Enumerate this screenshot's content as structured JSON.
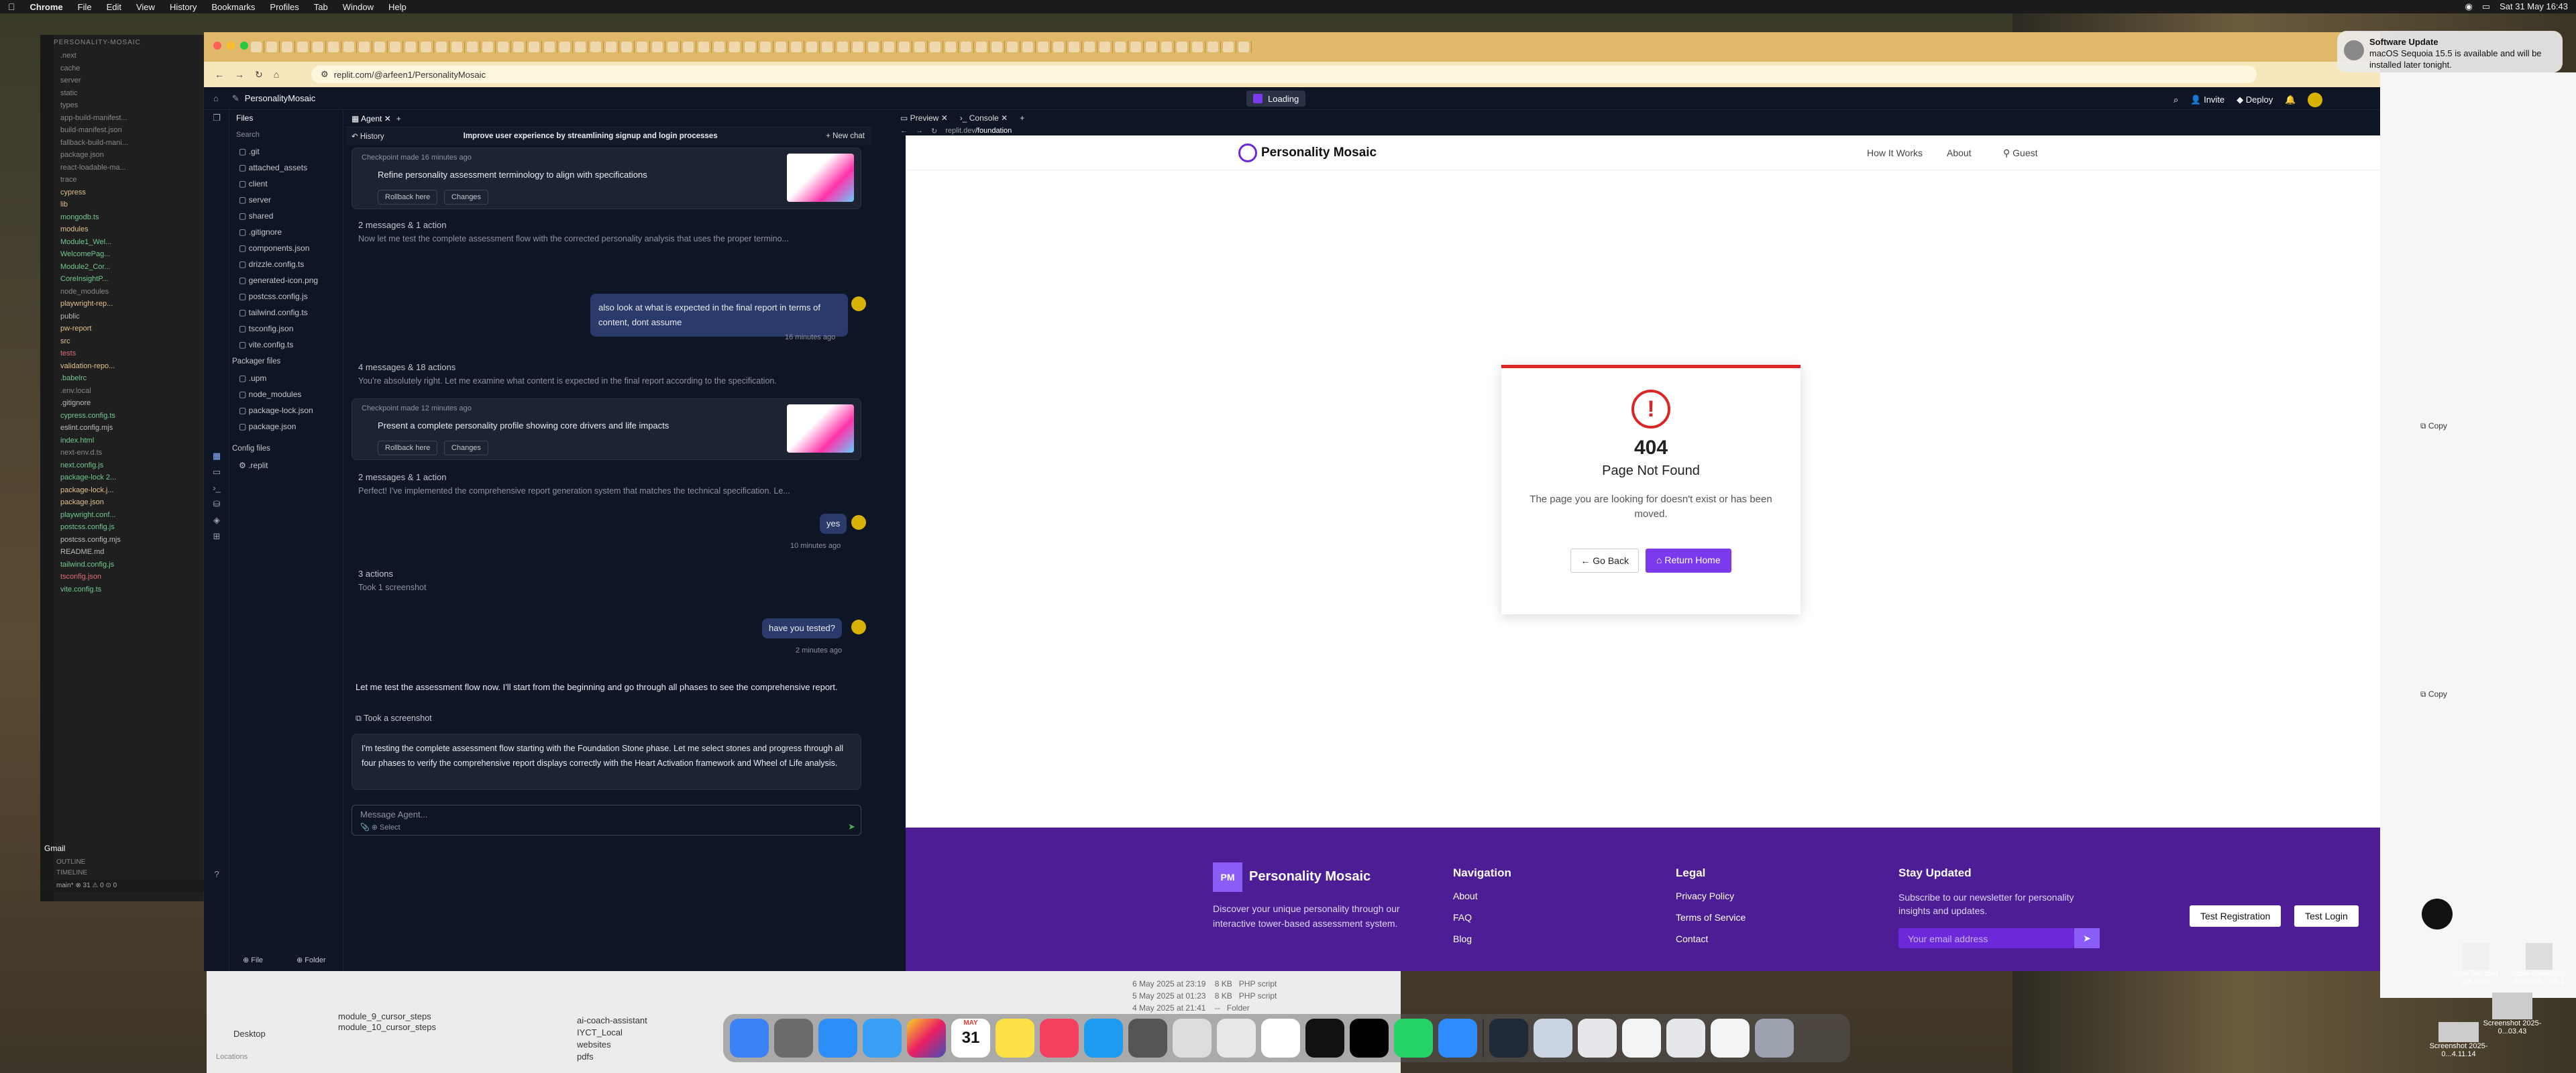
{
  "menubar": {
    "app": "Chrome",
    "items": [
      "File",
      "Edit",
      "View",
      "History",
      "Bookmarks",
      "Profiles",
      "Tab",
      "Window",
      "Help"
    ],
    "clock": "Sat 31 May 16:43"
  },
  "notification": {
    "title": "Software Update",
    "body": "macOS Sequoia 15.5 is available and will be installed later tonight."
  },
  "editor": {
    "title": "PERSONALITY-MOSAIC",
    "tree": [
      {
        "t": ".next",
        "c": "d"
      },
      {
        "t": "cache",
        "c": "d"
      },
      {
        "t": "server",
        "c": "d"
      },
      {
        "t": "static",
        "c": "d"
      },
      {
        "t": "types",
        "c": "d"
      },
      {
        "t": "app-build-manifest...",
        "c": "d"
      },
      {
        "t": "build-manifest.json",
        "c": "d"
      },
      {
        "t": "fallback-build-mani...",
        "c": "d"
      },
      {
        "t": "package.json",
        "c": "d"
      },
      {
        "t": "react-loadable-ma...",
        "c": "d"
      },
      {
        "t": "trace",
        "c": "d"
      },
      {
        "t": "cypress",
        "c": "m"
      },
      {
        "t": "lib",
        "c": "m"
      },
      {
        "t": "mongodb.ts",
        "c": "u"
      },
      {
        "t": "modules",
        "c": "m"
      },
      {
        "t": "Module1_Wel...",
        "c": "u"
      },
      {
        "t": "WelcomePag...",
        "c": "u"
      },
      {
        "t": "Module2_Cor...",
        "c": "u"
      },
      {
        "t": "CoreInsightP...",
        "c": "u"
      },
      {
        "t": "node_modules",
        "c": "d"
      },
      {
        "t": "playwright-rep...",
        "c": "m"
      },
      {
        "t": "public",
        "c": ""
      },
      {
        "t": "pw-report",
        "c": "m"
      },
      {
        "t": "src",
        "c": "m"
      },
      {
        "t": "tests",
        "c": "r"
      },
      {
        "t": "validation-repo...",
        "c": "m"
      },
      {
        "t": ".babelrc",
        "c": "u"
      },
      {
        "t": ".env.local",
        "c": "d"
      },
      {
        "t": ".gitignore",
        "c": ""
      },
      {
        "t": "cypress.config.ts",
        "c": "u"
      },
      {
        "t": "eslint.config.mjs",
        "c": ""
      },
      {
        "t": "index.html",
        "c": "u"
      },
      {
        "t": "next-env.d.ts",
        "c": "d"
      },
      {
        "t": "next.config.js",
        "c": "u"
      },
      {
        "t": "package-lock 2...",
        "c": "u"
      },
      {
        "t": "package-lock.j...",
        "c": "m"
      },
      {
        "t": "package.json",
        "c": "m"
      },
      {
        "t": "playwright.conf...",
        "c": "u"
      },
      {
        "t": "postcss.config.js",
        "c": "u"
      },
      {
        "t": "postcss.config.mjs",
        "c": ""
      },
      {
        "t": "README.md",
        "c": ""
      },
      {
        "t": "tailwind.config.js",
        "c": "u"
      },
      {
        "t": "tsconfig.json",
        "c": "r"
      },
      {
        "t": "vite.config.ts",
        "c": "u"
      }
    ],
    "outline": "OUTLINE",
    "timeline": "TIMELINE",
    "gmail": "Gmail",
    "status": "main* ⊗ 31 ⚠ 0 ⊙ 0"
  },
  "browser": {
    "url": "replit.com/@arfeen1/PersonalityMosaic"
  },
  "replit": {
    "project": "PersonalityMosaic",
    "status": "Loading",
    "invite": "Invite",
    "deploy": "Deploy",
    "files_title": "Files",
    "search": "Search",
    "files": [
      ".git",
      "attached_assets",
      "client",
      "server",
      "shared",
      ".gitignore",
      "components.json",
      "drizzle.config.ts",
      "generated-icon.png",
      "postcss.config.js",
      "tailwind.config.ts",
      "tsconfig.json",
      "vite.config.ts"
    ],
    "packager_title": "Packager files",
    "packager": [
      ".upm",
      "node_modules",
      "package-lock.json",
      "package.json"
    ],
    "config_title": "Config files",
    "config": [
      ".replit"
    ],
    "file_btn": "File",
    "folder_btn": "Folder"
  },
  "agent": {
    "tab": "Agent",
    "history": "History",
    "thread_title": "Improve user experience by streamlining signup and login processes",
    "new_chat": "New chat",
    "checkpoint1": {
      "meta": "Checkpoint made 16 minutes ago",
      "text": "Refine personality assessment terminology to align with specifications",
      "rollback": "Rollback here",
      "changes": "Changes"
    },
    "group1": {
      "title": "2 messages & 1 action",
      "text": "Now let me test the complete assessment flow with the corrected personality analysis that uses the proper termino..."
    },
    "user1": {
      "text": "also look at what is expected in the final report in terms of content, dont assume",
      "time": "16 minutes ago"
    },
    "group2": {
      "title": "4 messages & 18 actions",
      "text": "You're absolutely right. Let me examine what content is expected in the final report according to the specification."
    },
    "checkpoint2": {
      "meta": "Checkpoint made 12 minutes ago",
      "text": "Present a complete personality profile showing core drivers and life impacts",
      "rollback": "Rollback here",
      "changes": "Changes"
    },
    "group3": {
      "title": "2 messages & 1 action",
      "text": "Perfect! I've implemented the comprehensive report generation system that matches the technical specification. Le..."
    },
    "user2": {
      "text": "yes",
      "time": "10 minutes ago"
    },
    "group4": {
      "title": "3 actions",
      "text": "Took 1 screenshot"
    },
    "user3": {
      "text": "have you tested?",
      "time": "2 minutes ago"
    },
    "reply": "Let me test the assessment flow now. I'll start from the beginning and go through all phases to see the comprehensive report.",
    "screenshot_label": "Took a screenshot",
    "testing": "I'm testing the complete assessment flow starting with the Foundation Stone phase. Let me select stones and progress through all four phases to verify the comprehensive report displays correctly with the Heart Activation framework and Wheel of Life analysis.",
    "input_placeholder": "Message Agent...",
    "select": "Select"
  },
  "preview": {
    "tab_preview": "Preview",
    "tab_console": "Console",
    "url_host": "replit.dev",
    "url_path": "/foundation",
    "site_name": "Personality Mosaic",
    "nav": [
      "How It Works",
      "About",
      "Guest"
    ],
    "code": "404",
    "heading": "Page Not Found",
    "message": "The page you are looking for doesn't exist or has been moved.",
    "go_back": "Go Back",
    "return_home": "Return Home",
    "footer": {
      "logo": "PM",
      "brand": "Personality Mosaic",
      "tagline": "Discover your unique personality through our interactive tower-based assessment system.",
      "nav_title": "Navigation",
      "nav_links": [
        "About",
        "FAQ",
        "Blog"
      ],
      "legal_title": "Legal",
      "legal_links": [
        "Privacy Policy",
        "Terms of Service",
        "Contact"
      ],
      "stay_title": "Stay Updated",
      "stay_text": "Subscribe to our newsletter for personality insights and updates.",
      "email_placeholder": "Your email address",
      "test_reg": "Test Registration",
      "test_login": "Test Login"
    }
  },
  "finder": {
    "items": [
      "module_9_cursor_steps",
      "module_10_cursor_steps"
    ],
    "folders": [
      "ai-coach-assistant",
      "IYCT_Local",
      "websites",
      "pdfs"
    ],
    "rows": [
      {
        "d": "6 May 2025 at 23:19",
        "s": "8 KB",
        "k": "PHP script"
      },
      {
        "d": "5 May 2025 at 01:23",
        "s": "8 KB",
        "k": "PHP script"
      },
      {
        "d": "4 May 2025 at 21:41",
        "s": "--",
        "k": "Folder"
      }
    ],
    "desktop": "Desktop",
    "locations": "Locations"
  },
  "rightpanel": {
    "copy1": "Copy",
    "copy2": "Copy"
  },
  "desktop_files": [
    {
      "name": "base line chat gpt.docx"
    },
    {
      "name": "apple-developer-merchan...ion-2"
    },
    {
      "name": "Screenshot 2025-0...03.43"
    },
    {
      "name": "Screenshot 2025-0...4.11.14"
    }
  ],
  "dock_date": {
    "month": "MAY",
    "day": "31"
  },
  "colors": {
    "accent": "#7c3aed",
    "error": "#dc2626",
    "footer": "#4c1d95",
    "chrome_tab": "#dfb86a"
  }
}
